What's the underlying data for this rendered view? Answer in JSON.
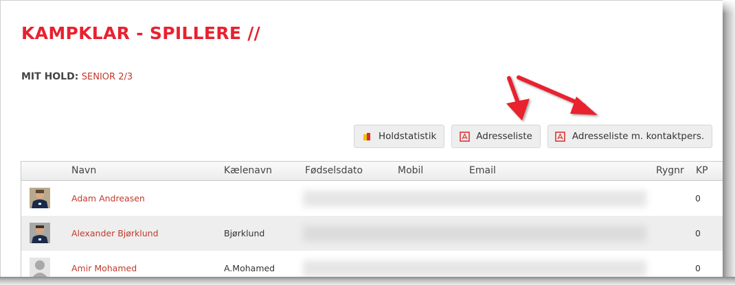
{
  "page": {
    "title": "KAMPKLAR - SPILLERE //"
  },
  "team": {
    "label": "MIT HOLD:",
    "value": "SENIOR 2/3"
  },
  "toolbar": {
    "buttons": [
      {
        "label": "Holdstatistik",
        "icon": "statistics-icon"
      },
      {
        "label": "Adresseliste",
        "icon": "pdf-icon"
      },
      {
        "label": "Adresseliste m. kontaktpers.",
        "icon": "pdf-icon"
      }
    ]
  },
  "table": {
    "columns": [
      "Navn",
      "Kælenavn",
      "Fødselsdato",
      "Mobil",
      "Email",
      "Rygnr",
      "KP"
    ],
    "rows": [
      {
        "name": "Adam Andreasen",
        "nickname": "",
        "kp": "0",
        "avatar": "player-photo"
      },
      {
        "name": "Alexander Bjørklund",
        "nickname": "Bjørklund",
        "kp": "0",
        "avatar": "player-photo"
      },
      {
        "name": "Amir Mohamed",
        "nickname": "A.Mohamed",
        "kp": "0",
        "avatar": "default-avatar"
      }
    ]
  },
  "colors": {
    "accent": "#e8212f",
    "link": "#c0392b",
    "annotation_arrow": "#e8212f"
  }
}
